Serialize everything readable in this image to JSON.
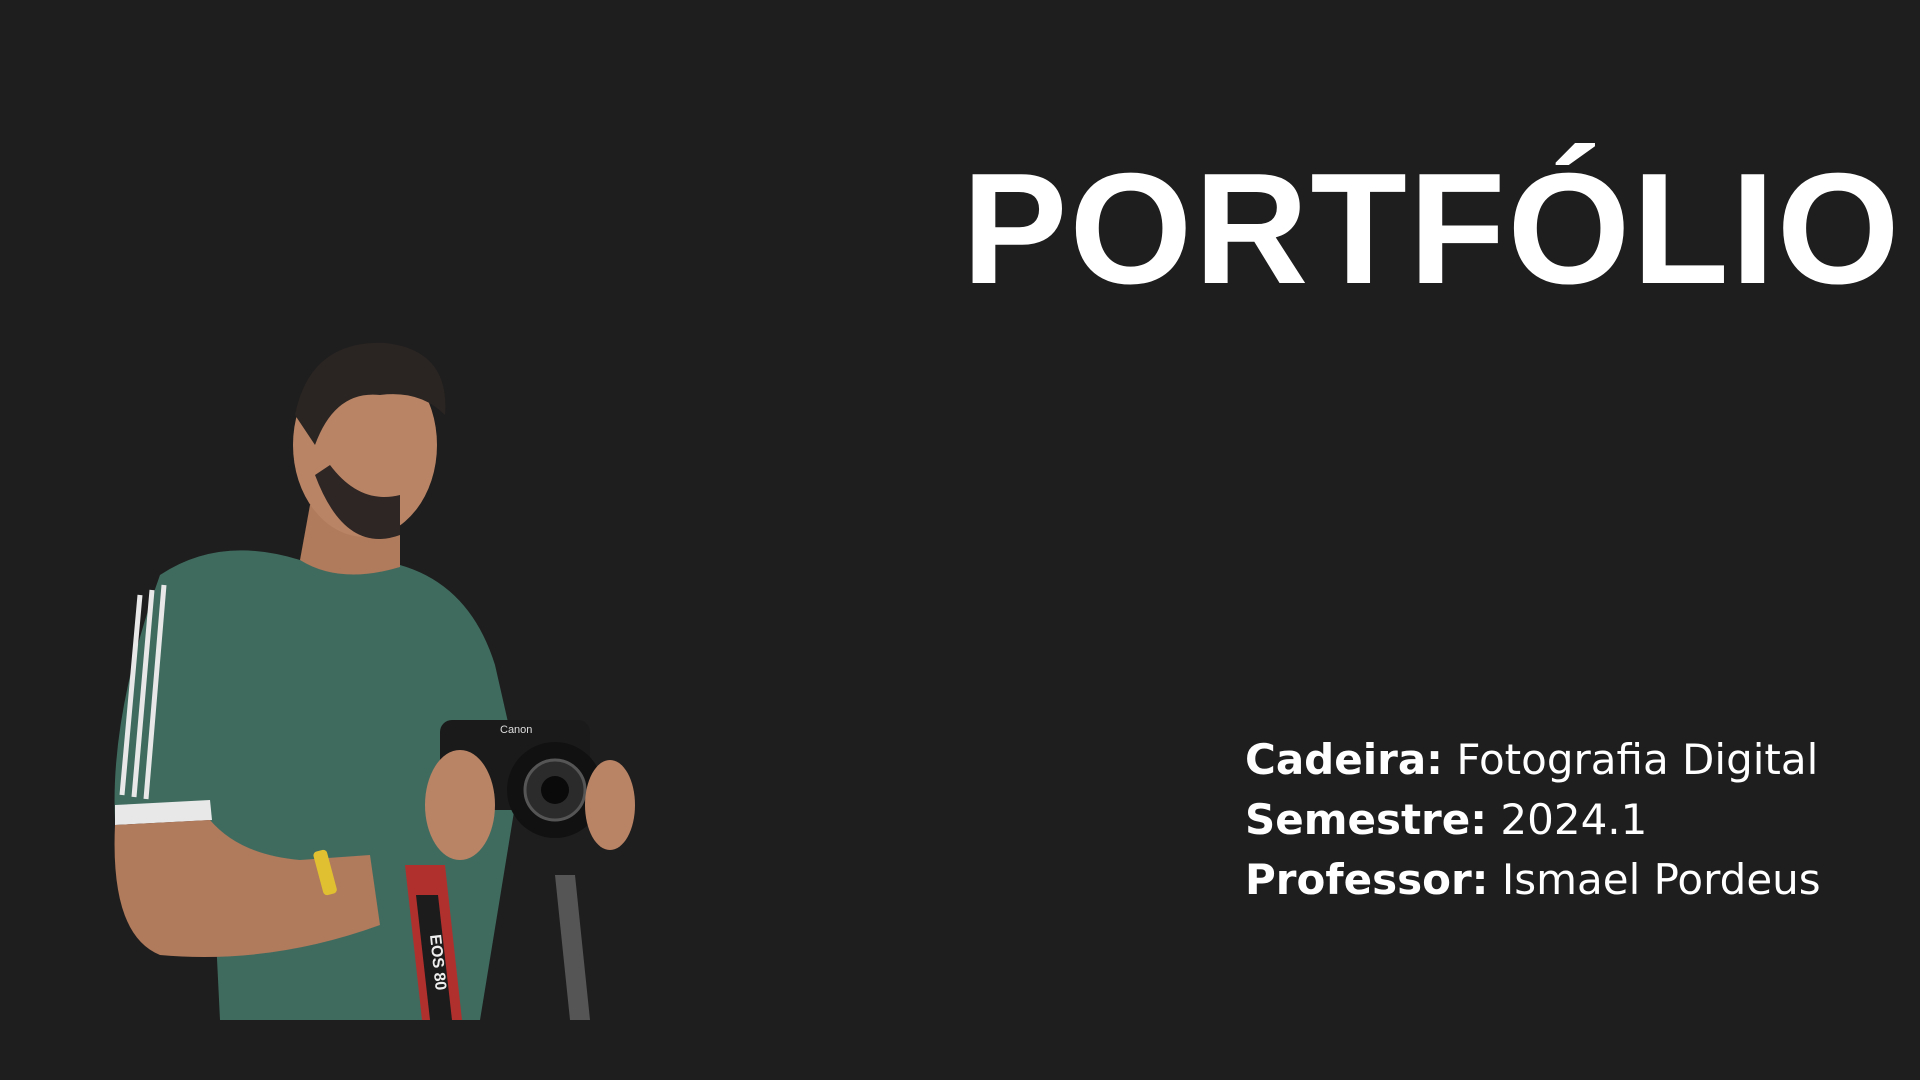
{
  "title": "PORTFÓLIO",
  "details": [
    {
      "label": "Cadeira:",
      "value": "Fotografia Digital"
    },
    {
      "label": "Semestre:",
      "value": "2024.1"
    },
    {
      "label": "Professor:",
      "value": "Ismael Pordeus"
    }
  ],
  "photo": {
    "camera_brand": "Canon",
    "strap_text": "EOS 80"
  },
  "colors": {
    "background": "#1f1e1e",
    "text": "#ffffff",
    "shirt": "#3f6b5f"
  }
}
